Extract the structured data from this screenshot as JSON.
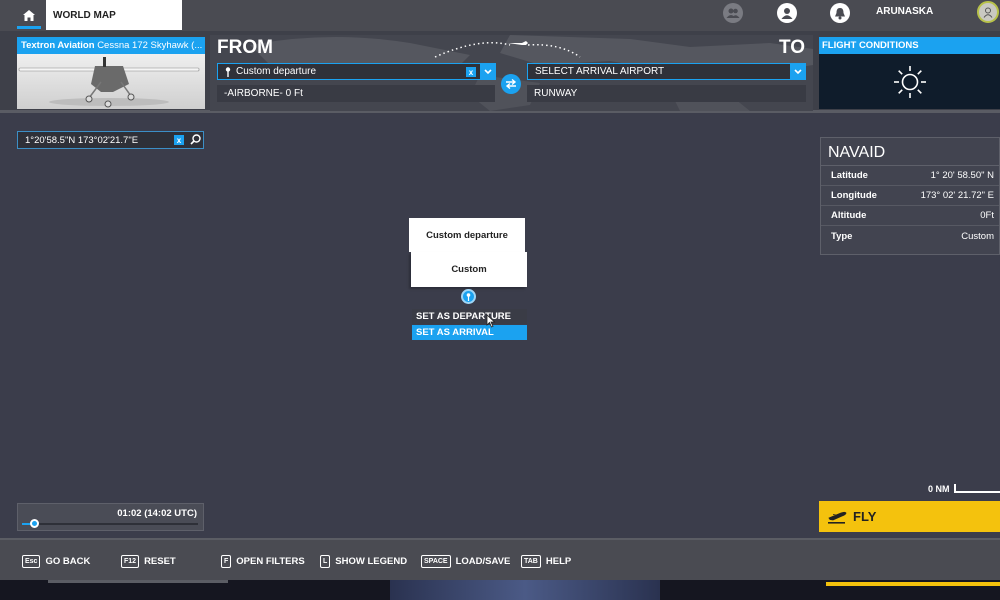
{
  "topbar": {
    "home_icon": "home-icon",
    "tab_label": "WORLD MAP",
    "icons": [
      "group-icon",
      "profile-icon",
      "bell-icon"
    ],
    "username": "ARUNASKA",
    "avatar_icon": "user-avatar-icon"
  },
  "aircraft": {
    "manufacturer": "Textron Aviation",
    "model": "Cessna 172 Skyhawk (..."
  },
  "route": {
    "from_label": "FROM",
    "to_label": "TO",
    "departure_value": "Custom departure",
    "departure_clear": "x",
    "departure_altitude": "-AIRBORNE- 0 Ft",
    "arrival_placeholder": "SELECT ARRIVAL AIRPORT",
    "arrival_runway": "RUNWAY"
  },
  "conditions": {
    "title": "FLIGHT CONDITIONS",
    "weather_icon": "sun-icon"
  },
  "search": {
    "value": "1°20'58.5\"N 173°02'21.7\"E",
    "clear": "x"
  },
  "navaid": {
    "title": "NAVAID",
    "rows": [
      {
        "label": "Latitude",
        "value": "1° 20' 58.50\" N"
      },
      {
        "label": "Longitude",
        "value": "173° 02' 21.72\" E"
      },
      {
        "label": "Altitude",
        "value": "0Ft"
      },
      {
        "label": "Type",
        "value": "Custom"
      }
    ]
  },
  "map_popup": {
    "title": "Custom departure",
    "subtitle": "Custom",
    "menu": [
      "SET AS DEPARTURE",
      "SET AS ARRIVAL"
    ],
    "highlighted_index": 1
  },
  "time": {
    "label": "01:02 (14:02 UTC)",
    "slider_fraction": 0.05
  },
  "scale": {
    "label": "0 NM"
  },
  "fly": {
    "label": "FLY"
  },
  "bottom_hints": [
    {
      "key": "Esc",
      "label": "GO BACK"
    },
    {
      "key": "F12",
      "label": "RESET"
    },
    {
      "key": "F",
      "label": "OPEN FILTERS"
    },
    {
      "key": "L",
      "label": "SHOW LEGEND"
    },
    {
      "key": "SPACE",
      "label": "LOAD/SAVE"
    },
    {
      "key": "TAB",
      "label": "HELP"
    }
  ],
  "colors": {
    "accent": "#1ba2f0",
    "fly": "#f4c20d",
    "background": "#3b3d4b"
  }
}
